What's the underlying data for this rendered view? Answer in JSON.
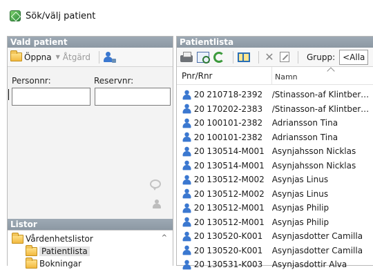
{
  "window": {
    "title": "Sök/välj patient"
  },
  "left_panel": {
    "header": "Vald patient",
    "toolbar": {
      "open_label": "Öppna",
      "action_label": "Åtgärd"
    },
    "fields": {
      "personnr_label": "Personnr:",
      "reservnr_label": "Reservnr:",
      "personnr_value": "",
      "reservnr_value": ""
    },
    "lists": {
      "header": "Listor",
      "items": [
        {
          "label": "Vårdenhetslistor",
          "selected": false
        },
        {
          "label": "Patientlista",
          "selected": true
        },
        {
          "label": "Bokningar",
          "selected": false
        }
      ]
    }
  },
  "right_panel": {
    "header": "Patientlista",
    "toolbar": {
      "group_label": "Grupp:",
      "group_value": "<Alla"
    },
    "columns": {
      "pnr": "Pnr/Rnr",
      "name": "Namn"
    },
    "rows": [
      {
        "prefix": "20",
        "pnr": "210718-2392",
        "name": "/Stinasson-af Klintberg/..."
      },
      {
        "prefix": "20",
        "pnr": "170202-2383",
        "name": "/Stinasson-af Klintberg/..."
      },
      {
        "prefix": "20",
        "pnr": "100101-2382",
        "name": "Adriansson Tina"
      },
      {
        "prefix": "20",
        "pnr": "100101-2382",
        "name": "Adriansson Tina"
      },
      {
        "prefix": "20",
        "pnr": "130514-M001",
        "name": "Asynjahsson Nicklas"
      },
      {
        "prefix": "20",
        "pnr": "130514-M001",
        "name": "Asynjahsson Nicklas"
      },
      {
        "prefix": "20",
        "pnr": "130512-M002",
        "name": "Asynjas Linus"
      },
      {
        "prefix": "20",
        "pnr": "130512-M002",
        "name": "Asynjas Linus"
      },
      {
        "prefix": "20",
        "pnr": "130512-M001",
        "name": "Asynjas Philip"
      },
      {
        "prefix": "20",
        "pnr": "130512-M001",
        "name": "Asynjas Philip"
      },
      {
        "prefix": "20",
        "pnr": "130520-K001",
        "name": "Asynjasdotter Camilla"
      },
      {
        "prefix": "20",
        "pnr": "130520-K001",
        "name": "Asynjasdotter Camilla"
      },
      {
        "prefix": "20",
        "pnr": "130531-K003",
        "name": "Asynjasdottir Alva"
      }
    ]
  }
}
